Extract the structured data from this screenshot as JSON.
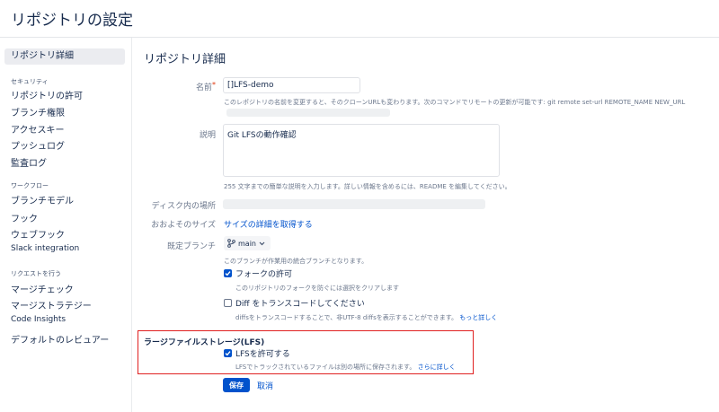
{
  "page": {
    "title": "リポジトリの設定"
  },
  "sidebar": {
    "active_item": "リポジトリ詳細",
    "sections": [
      {
        "heading": "セキュリティ",
        "items": [
          "リポジトリの許可",
          "ブランチ権限",
          "アクセスキー",
          "プッシュログ",
          "監査ログ"
        ]
      },
      {
        "heading": "ワークフロー",
        "items": [
          "ブランチモデル",
          "フック",
          "ウェブフック",
          "Slack integration"
        ]
      },
      {
        "heading": "リクエストを行う",
        "items": [
          "マージチェック",
          "マージストラテジー",
          "Code Insights",
          "デフォルトのレビュアー"
        ]
      }
    ]
  },
  "details": {
    "section_title": "リポジトリ詳細",
    "name_label": "名前",
    "required_mark": "*",
    "name_value": "[]LFS-demo",
    "name_help": "このレポジトリの名前を変更すると、そのクローンURLも変わります。次のコマンドでリモートの更新が可能です: git remote set-url REMOTE_NAME NEW_URL",
    "description_label": "説明",
    "description_value": "Git LFSの動作確認",
    "description_help": "255 文字までの簡単な説明を入力します。詳しい情報を含めるには、README を編集してください。",
    "disk_label": "ディスク内の場所",
    "size_label": "おおよそのサイズ",
    "size_link": "サイズの詳細を取得する",
    "default_branch_label": "既定ブランチ",
    "default_branch_value": "main",
    "default_branch_help": "このブランチが作業用の統合ブランチとなります。",
    "fork_label": "フォークの許可",
    "fork_help": "このリポジトリのフォークを防ぐには選択をクリアします",
    "fork_checked": true,
    "diff_label": "Diff をトランスコードしてください",
    "diff_help": "diffsをトランスコードすることで、非UTF-8 diffsを表示することができます。",
    "diff_more_link": "もっと詳しく",
    "diff_checked": false
  },
  "lfs": {
    "title": "ラージファイルストレージ(LFS)",
    "allow_label": "LFSを許可する",
    "allow_checked": true,
    "help": "LFSでトラックされているファイルは別の場所に保存されます。",
    "more_link": "さらに詳しく",
    "highlight_color": "#e02020"
  },
  "actions": {
    "save_label": "保存",
    "cancel_label": "取消"
  },
  "colors": {
    "primary": "#0052cc",
    "text": "#172b4d",
    "muted": "#6b778c"
  },
  "icons": {
    "branch": "branch-icon",
    "chevron": "chevron-down-icon",
    "check": "check-icon"
  }
}
